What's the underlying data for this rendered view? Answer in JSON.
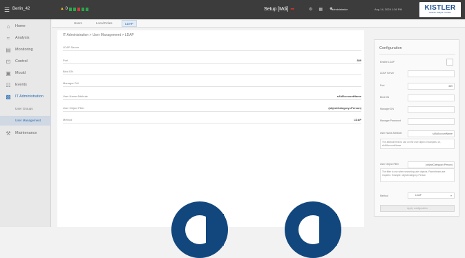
{
  "topbar": {
    "device": "Berlin_42",
    "alarm_count": "0",
    "setup": "Setup [Mdi]",
    "user": "administrator",
    "time": "Aug 14, 2024 1:36 PM",
    "logo": "KISTLER",
    "logo_tag": "measure. analyze. innovate."
  },
  "sidebar": {
    "items": [
      {
        "label": "Home",
        "icon": "home-icon"
      },
      {
        "label": "Analysis",
        "icon": "chart-icon"
      },
      {
        "label": "Monitoring",
        "icon": "monitor-icon"
      },
      {
        "label": "Control",
        "icon": "control-icon"
      },
      {
        "label": "Mould",
        "icon": "mould-icon"
      },
      {
        "label": "Events",
        "icon": "events-icon"
      },
      {
        "label": "IT Administration",
        "icon": "network-icon"
      },
      {
        "label": "Maintenance",
        "icon": "wrench-icon"
      }
    ],
    "sub_items": [
      {
        "label": "User Groups"
      },
      {
        "label": "User Management"
      }
    ]
  },
  "tabs": [
    "Users",
    "Local Roles",
    "LDAP"
  ],
  "breadcrumb": "IT Administration > User Management > LDAP",
  "details": [
    {
      "key": "LDAP Server",
      "value": ""
    },
    {
      "key": "Port",
      "value": "389"
    },
    {
      "key": "Bind DN",
      "value": ""
    },
    {
      "key": "Manager DN",
      "value": ""
    },
    {
      "key": "User Name Attribute",
      "value": "sAMAccountName"
    },
    {
      "key": "User Object Filter",
      "value": "(objectCategory=Person)"
    },
    {
      "key": "Method",
      "value": "LDAP"
    }
  ],
  "config": {
    "title": "Configuration",
    "enable_label": "Enable LDAP",
    "server_label": "LDAP Server",
    "port_label": "Port",
    "port_value": "389",
    "bind_label": "Bind DN",
    "manager_label": "Manager DN",
    "password_label": "Manager Password",
    "uname_label": "User Name Attribute",
    "uname_value": "sAMAccountName",
    "uname_help": "The attribute field to use on the user object. Examples: cn, sAMAccountName",
    "filter_label": "User Object Filter",
    "filter_value": "(objectCategory=Person)",
    "filter_help": "The filter to use when searching user objects. Parentheses are required. Example: objectCategory=Person",
    "method_label": "Method",
    "method_value": "LDAP",
    "apply_label": "Apply configuration"
  }
}
